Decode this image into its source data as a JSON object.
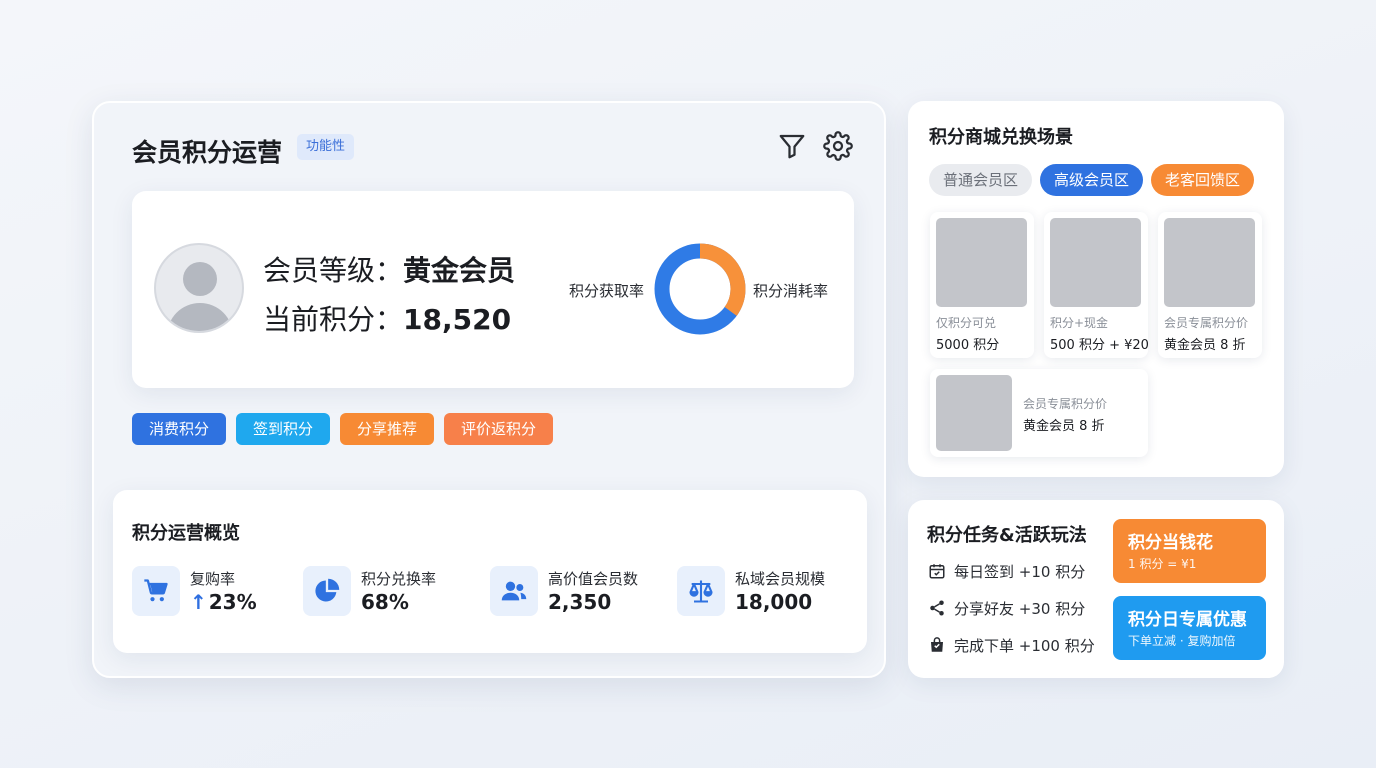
{
  "main": {
    "title": "会员积分运营",
    "tag": "功能性",
    "member": {
      "level_label": "会员等级：",
      "level_value": "黄金会员",
      "points_label": "当前积分：",
      "points_value": "18,520"
    },
    "donut": {
      "left_label": "积分获取率",
      "right_label": "积分消耗率",
      "orange_share": 0.35,
      "blue_color": "#2f7be6",
      "orange_color": "#f7913a"
    },
    "tags": [
      {
        "label": "消费积分",
        "color": "#2f72e0"
      },
      {
        "label": "签到积分",
        "color": "#1fa8ee"
      },
      {
        "label": "分享推荐",
        "color": "#f78a34"
      },
      {
        "label": "评价返积分",
        "color": "#f7804a"
      }
    ],
    "overview": {
      "title": "积分运营概览",
      "metrics": [
        {
          "icon": "shopping-cart-icon",
          "label": "复购率",
          "arrow": "↑",
          "value": "23%"
        },
        {
          "icon": "pie-chart-icon",
          "label": "积分兑换率",
          "value": "68%"
        },
        {
          "icon": "users-icon",
          "label": "高价值会员数",
          "value": "2,350"
        },
        {
          "icon": "scale-icon",
          "label": "私域会员规模",
          "value": "18,000"
        }
      ]
    }
  },
  "mall": {
    "title": "积分商城兑换场景",
    "zones": [
      {
        "label": "普通会员区",
        "bg": "#e9ebef",
        "fg": "#6b7079"
      },
      {
        "label": "高级会员区",
        "bg": "#2f72e0",
        "fg": "#ffffff"
      },
      {
        "label": "老客回馈区",
        "bg": "#f78a34",
        "fg": "#ffffff"
      }
    ],
    "products": [
      {
        "sub": "仅积分可兑",
        "main": "5000 积分"
      },
      {
        "sub": "积分+现金",
        "main": "500 积分 + ¥20"
      },
      {
        "sub": "会员专属积分价",
        "main": "黄金会员 8 折"
      },
      {
        "sub": "会员专属积分价",
        "main": "黄金会员 8 折"
      }
    ]
  },
  "tasks": {
    "title": "积分任务&活跃玩法",
    "items": [
      {
        "icon": "calendar-check-icon",
        "label": "每日签到 +10 积分"
      },
      {
        "icon": "share-icon",
        "label": "分享好友 +30 积分"
      },
      {
        "icon": "shopping-bag-icon",
        "label": "完成下单 +100 积分"
      }
    ],
    "promos": [
      {
        "title": "积分当钱花",
        "sub": "1 积分 = ¥1",
        "color": "#f78a34"
      },
      {
        "title": "积分日专属优惠",
        "sub": "下单立减 · 复购加倍",
        "color": "#1f9bf0"
      }
    ]
  }
}
